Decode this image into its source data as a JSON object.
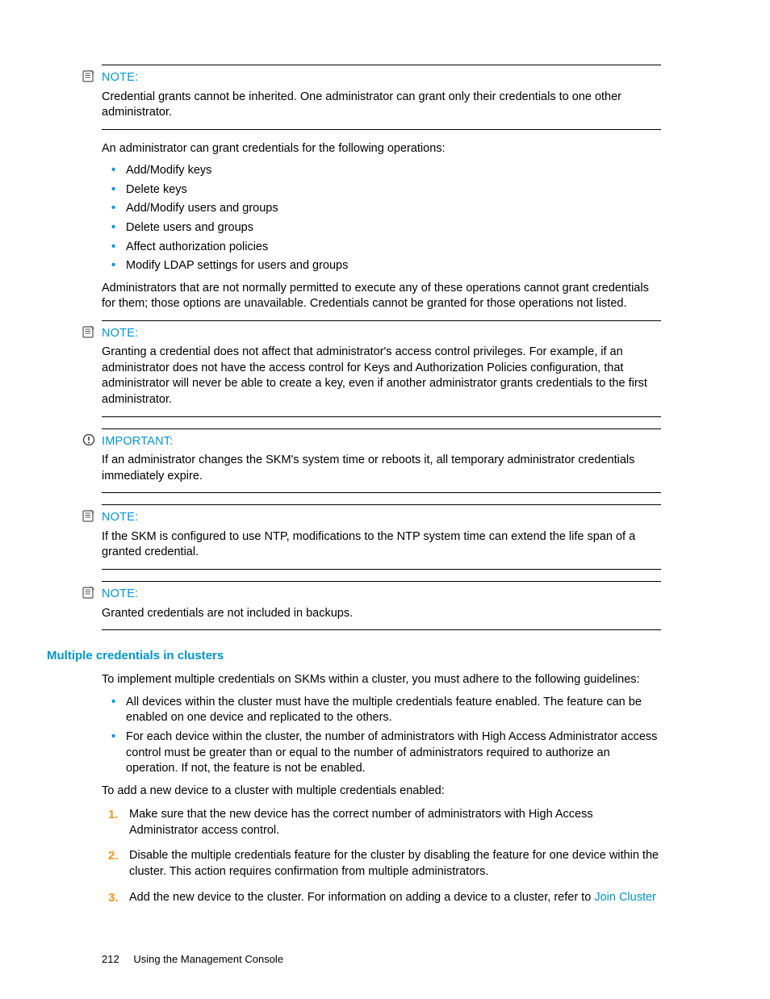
{
  "callouts": {
    "note1": {
      "label": "NOTE:",
      "body": "Credential grants cannot be inherited. One administrator can grant only their credentials to one other administrator."
    },
    "note2": {
      "label": "NOTE:",
      "body": "Granting a credential does not affect that administrator's access control privileges. For example, if an administrator does not have the access control for Keys and Authorization Policies configuration, that administrator will never be able to create a key, even if another administrator grants credentials to the first administrator."
    },
    "important1": {
      "label": "IMPORTANT:",
      "body": "If an administrator changes the SKM's system time or reboots it, all temporary administrator credentials immediately expire."
    },
    "note3": {
      "label": "NOTE:",
      "body": "If the SKM is configured to use NTP, modifications to the NTP system time can extend the life span of a granted credential."
    },
    "note4": {
      "label": "NOTE:",
      "body": "Granted credentials are not included in backups."
    }
  },
  "body": {
    "grant_intro": "An administrator can grant credentials for the following operations:",
    "grant_ops": [
      "Add/Modify keys",
      "Delete keys",
      "Add/Modify users and groups",
      "Delete users and groups",
      "Affect authorization policies",
      "Modify LDAP settings for users and groups"
    ],
    "grant_post": "Administrators that are not normally permitted to execute any of these operations cannot grant credentials for them; those options are unavailable. Credentials cannot be granted for those operations not listed."
  },
  "section": {
    "heading": "Multiple credentials in clusters",
    "intro": "To implement multiple credentials on SKMs within a cluster, you must adhere to the following guidelines:",
    "guidelines": [
      "All devices within the cluster must have the multiple credentials feature enabled. The feature can be enabled on one device and replicated to the others.",
      "For each device within the cluster, the number of administrators with High Access Administrator access control must be greater than or equal to the number of administrators required to authorize an operation. If not, the feature is not be enabled."
    ],
    "add_intro": "To add a new device to a cluster with multiple credentials enabled:",
    "steps": [
      "Make sure that the new device has the correct number of administrators with High Access Administrator access control.",
      "Disable the multiple credentials feature for the cluster by disabling the feature for one device within the cluster. This action requires confirmation from multiple administrators."
    ],
    "step3_pre": "Add the new device to the cluster. For information on adding a device to a cluster, refer to ",
    "step3_link": "Join Cluster"
  },
  "footer": {
    "page_number": "212",
    "chapter": "Using the Management Console"
  }
}
